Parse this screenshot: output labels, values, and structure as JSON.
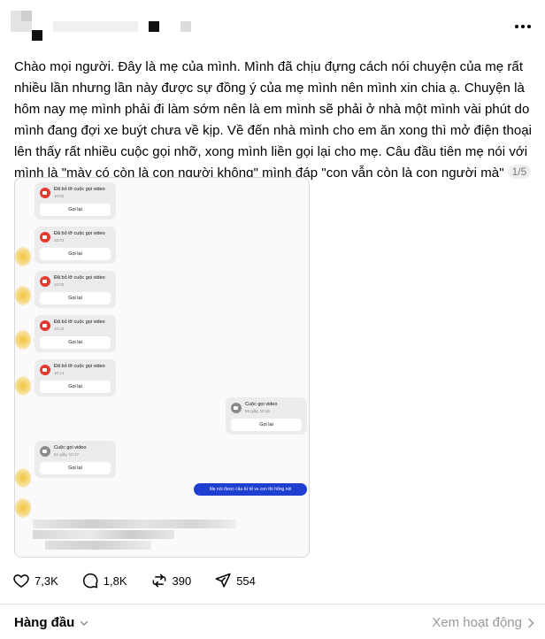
{
  "post": {
    "lines": [
      "Chào mọi người. Đây là mẹ của mình. Mình đã chịu đựng cách nói chuyện của mẹ rất",
      "nhiều lần nhưng lần này được sự đồng ý của mẹ mình nên mình xin chia ạ. Chuyện là",
      "hôm nay mẹ mình phải đi làm sớm nên là em mình sẽ phải ở nhà một mình vài phút do",
      "mình đang đợi xe buýt chưa về kịp. Về đến nhà mình cho em ăn xong thì mở điện thoại",
      "lên thấy rất nhiều cuộc gọi nhỡ, xong mình liền gọi lại cho mẹ. Câu đầu tiên mẹ nói với",
      "mình là \"mày có còn là con người không\" mình đáp \"con vẫn còn là con người mà\""
    ],
    "counter": "1/5"
  },
  "screenshot": {
    "missed_calls": [
      {
        "title": "Đã bỏ lỡ cuộc gọi video",
        "time": "10:02",
        "button": "Gọi lại"
      },
      {
        "title": "Đã bỏ lỡ cuộc gọi video",
        "time": "10:03",
        "button": "Gọi lại"
      },
      {
        "title": "Đã bỏ lỡ cuộc gọi video",
        "time": "10:05",
        "button": "Gọi lại"
      },
      {
        "title": "Đã bỏ lỡ cuộc gọi video",
        "time": "10:10",
        "button": "Gọi lại"
      },
      {
        "title": "Đã bỏ lỡ cuộc gọi video",
        "time": "10:14",
        "button": "Gọi lại"
      }
    ],
    "outgoing_call": {
      "title": "Cuộc gọi video",
      "time": "59 giây, 10:16",
      "button": "Gọi lại"
    },
    "incoming_call": {
      "title": "Cuộc gọi video",
      "time": "51 giây, 10:17",
      "button": "Gọi lại"
    },
    "message": "Mẹ nói được câu từ tế vs con thì hổng nói"
  },
  "actions": {
    "likes": "7,3K",
    "comments": "1,8K",
    "reposts": "390",
    "shares": "554"
  },
  "footer": {
    "sort_label": "Hàng đầu",
    "activity_label": "Xem hoạt động"
  },
  "colors": {
    "missed_icon": "#e5392e",
    "bubble": "#1f3fd1",
    "glow": "#f2c53b"
  }
}
